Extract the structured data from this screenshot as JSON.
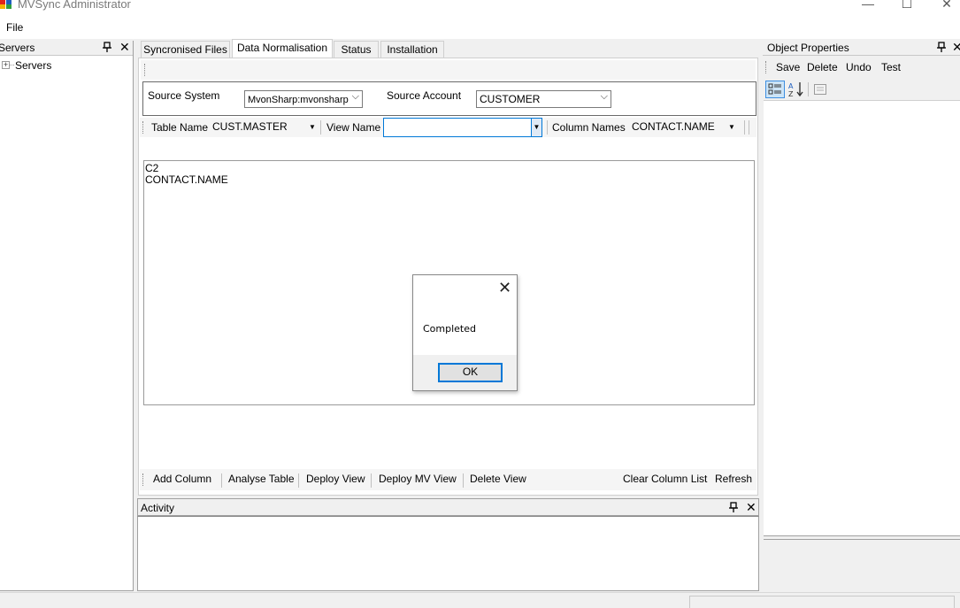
{
  "window": {
    "title": "MVSync Administrator",
    "minimize_glyph": "—",
    "maximize_glyph": "☐",
    "close_glyph": "✕"
  },
  "menu": {
    "file": "File"
  },
  "servers_pane": {
    "title": "Servers",
    "tree": {
      "expander": "+",
      "root_label": "Servers"
    }
  },
  "tabs": [
    {
      "label": "Syncronised Files",
      "active": false
    },
    {
      "label": "Data Normalisation",
      "active": true
    },
    {
      "label": "Status",
      "active": false
    },
    {
      "label": "Installation",
      "active": false
    }
  ],
  "source": {
    "system_label": "Source System",
    "system_value": "MvonSharp:mvonsharp",
    "account_label": "Source Account",
    "account_value": "CUSTOMER"
  },
  "filter_toolbar": {
    "table_label": "Table Name",
    "table_value": "CUST.MASTER",
    "view_label": "View Name",
    "view_value": "",
    "column_label": "Column Names",
    "column_value": "CONTACT.NAME"
  },
  "column_list": {
    "lines": [
      "C2",
      "CONTACT.NAME"
    ]
  },
  "actions": {
    "add_column": "Add Column",
    "analyse_table": "Analyse Table",
    "deploy_view": "Deploy View",
    "deploy_mv_view": "Deploy MV View",
    "delete_view": "Delete View",
    "clear_column_list": "Clear Column List",
    "refresh": "Refresh"
  },
  "activity_pane": {
    "title": "Activity"
  },
  "properties_pane": {
    "title": "Object Properties",
    "toolbar": {
      "save": "Save",
      "delete": "Delete",
      "undo": "Undo",
      "test": "Test"
    }
  },
  "dialog": {
    "message": "Completed",
    "ok_label": "OK",
    "close_glyph": "✕"
  },
  "colors": {
    "accent": "#0078d7",
    "window_bg": "#f0f0f0",
    "panel_bg": "#ffffff"
  }
}
